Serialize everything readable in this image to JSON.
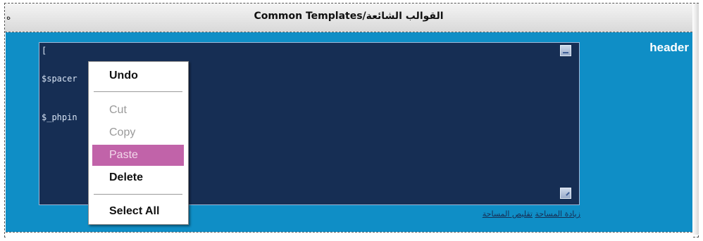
{
  "title": {
    "text": "Common Templates/القوالب الشائعة",
    "edge_text": "ه"
  },
  "field": {
    "label": "header"
  },
  "editor": {
    "lines": [
      "[",
      "$spacer",
      "$_phpin"
    ]
  },
  "links": {
    "increase": "زيادة المساحة",
    "decrease": "تقليص المساحة"
  },
  "context_menu": {
    "undo": "Undo",
    "cut": "Cut",
    "copy": "Copy",
    "paste": "Paste",
    "delete": "Delete",
    "select_all": "Select All"
  },
  "colors": {
    "panel": "#0f8ec6",
    "editor_bg": "#162e54",
    "menu_highlight": "#c163a9"
  }
}
